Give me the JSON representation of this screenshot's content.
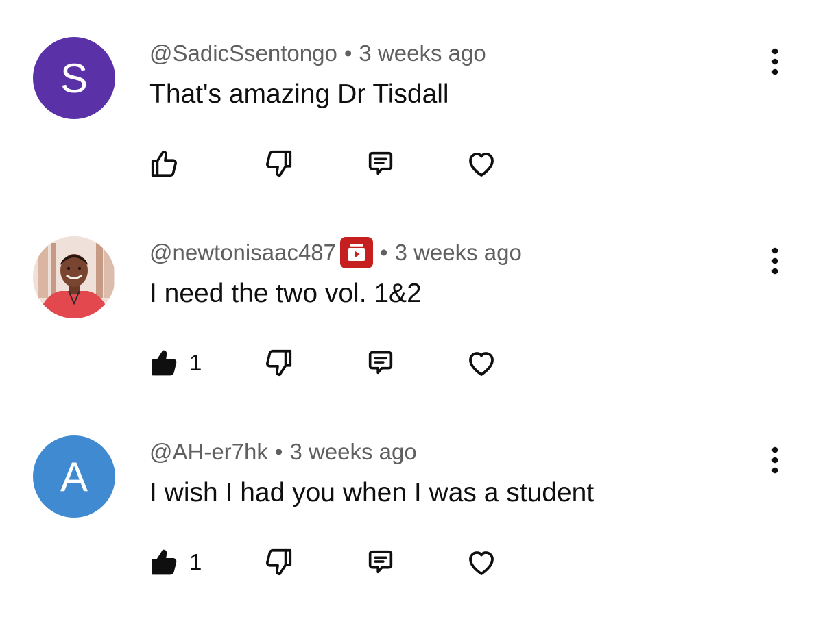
{
  "comments": [
    {
      "author": "@SadicSsentongo",
      "separator": "•",
      "time": "3 weeks ago",
      "text": "That's amazing Dr Tisdall",
      "avatar_letter": "S",
      "avatar_color": "#5a31a6",
      "has_badge": false,
      "liked": false,
      "like_count": ""
    },
    {
      "author": "@newtonisaac487",
      "separator": "•",
      "time": "3 weeks ago",
      "text": "I need the two vol. 1&2",
      "avatar_letter": "",
      "avatar_color": "",
      "has_badge": true,
      "liked": true,
      "like_count": "1"
    },
    {
      "author": "@AH-er7hk",
      "separator": "•",
      "time": "3 weeks ago",
      "text": "I wish I had you when I was a student",
      "avatar_letter": "A",
      "avatar_color": "#3f8ad0",
      "has_badge": false,
      "liked": true,
      "like_count": "1"
    }
  ],
  "icons": {
    "like": "thumbs-up-icon",
    "dislike": "thumbs-down-icon",
    "reply": "reply-icon",
    "heart": "heart-icon",
    "more": "more-vert-icon",
    "badge": "membership-badge-icon"
  },
  "colors": {
    "badge": "#c61f1f",
    "meta_text": "#606060",
    "primary_text": "#0f0f0f"
  }
}
